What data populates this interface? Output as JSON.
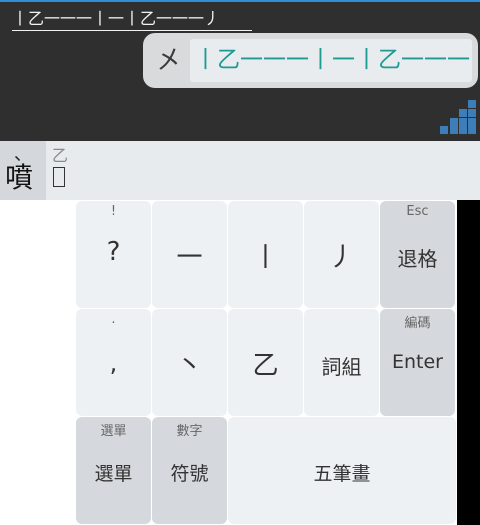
{
  "input": {
    "text": "丨乙一一一丨一丨乙一一一丿"
  },
  "composition": {
    "root": "㐅",
    "strokes": "丨乙一一一丨一丨乙一一一丿"
  },
  "candidates": {
    "selected_mark": "、",
    "selected": "噴",
    "next_top": "乙",
    "next_bottom": ""
  },
  "keyboard": {
    "row1": [
      {
        "hint": "!",
        "label": "?"
      },
      {
        "hint": "",
        "label": "一"
      },
      {
        "hint": "",
        "label": "丨"
      },
      {
        "hint": "",
        "label": "丿"
      },
      {
        "hint": "Esc",
        "label": "退格"
      }
    ],
    "row2": [
      {
        "hint": ".",
        "label": ","
      },
      {
        "hint": "",
        "label": "丶"
      },
      {
        "hint": "",
        "label": "乙"
      },
      {
        "hint": "",
        "label": "詞組"
      },
      {
        "hint": "編碼",
        "label": "Enter"
      }
    ],
    "row3": [
      {
        "hint": "選單",
        "label": "選單"
      },
      {
        "hint": "數字",
        "label": "符號"
      },
      {
        "hint": "",
        "label": "五筆畫"
      }
    ]
  }
}
